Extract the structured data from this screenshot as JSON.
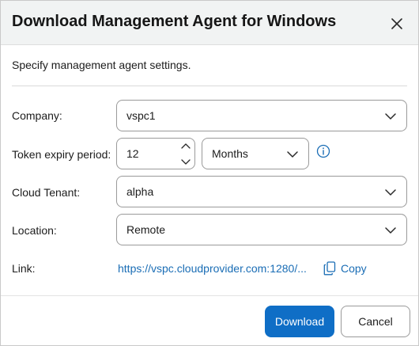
{
  "dialog": {
    "title": "Download Management Agent for Windows",
    "subtitle": "Specify management agent settings."
  },
  "form": {
    "company": {
      "label": "Company:",
      "value": "vspc1"
    },
    "token_expiry": {
      "label": "Token expiry period:",
      "amount": "12",
      "unit": "Months"
    },
    "cloud_tenant": {
      "label": "Cloud Tenant:",
      "value": "alpha"
    },
    "location": {
      "label": "Location:",
      "value": "Remote"
    },
    "link": {
      "label": "Link:",
      "url": "https://vspc.cloudprovider.com:1280/...",
      "copy_label": "Copy"
    }
  },
  "footer": {
    "download_label": "Download",
    "cancel_label": "Cancel"
  },
  "colors": {
    "accent": "#0f6ec6",
    "link": "#1a6db5",
    "header_bg": "#f1f3f3"
  },
  "icons": {
    "close": "close-icon",
    "dropdown": "chevron-down-icon",
    "info": "info-icon",
    "copy": "copy-icon"
  }
}
